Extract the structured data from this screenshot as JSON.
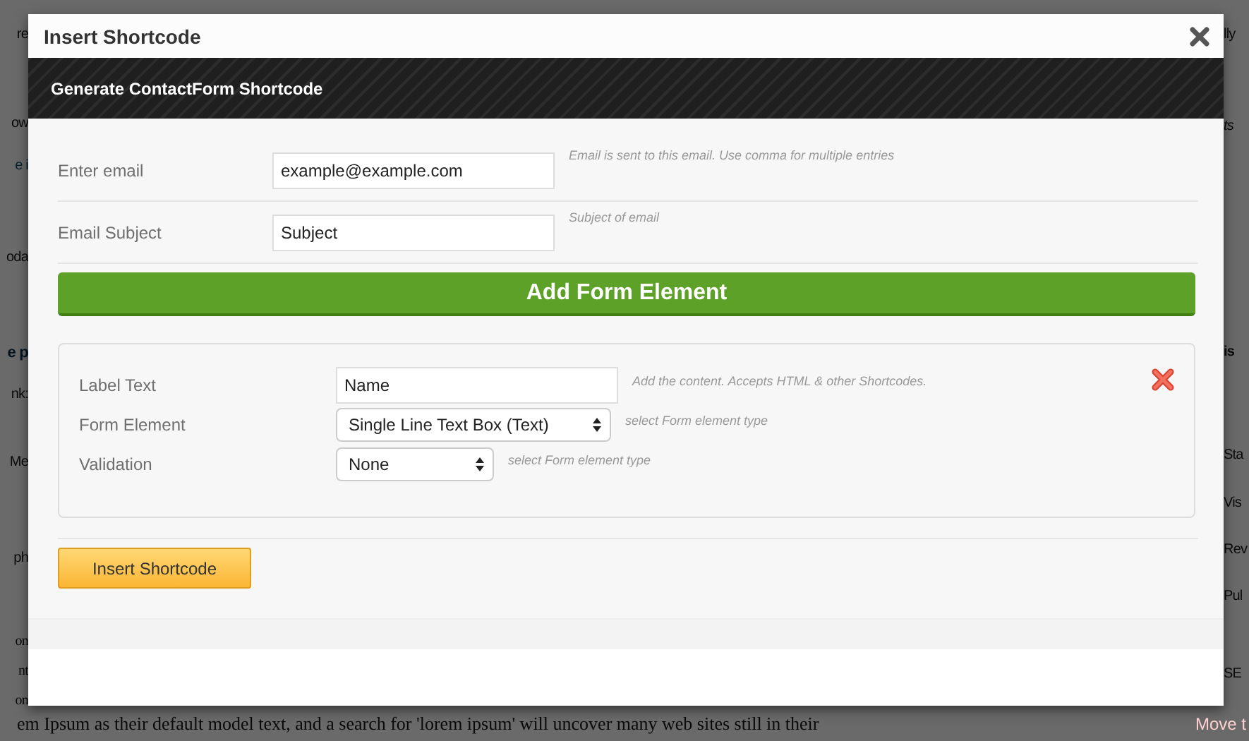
{
  "backdrop": {
    "left_fragments": [
      {
        "text": "re",
        "kind": "plain"
      },
      {
        "text": "ow",
        "kind": "plain"
      },
      {
        "text": "e i",
        "kind": "link"
      },
      {
        "text": "oda",
        "kind": "plain"
      },
      {
        "text": "e p",
        "kind": "heading"
      },
      {
        "text": "nk:",
        "kind": "plain"
      },
      {
        "text": "Me",
        "kind": "plain"
      },
      {
        "text": "ph",
        "kind": "plain"
      },
      {
        "text": "on",
        "kind": "serif"
      },
      {
        "text": "nt",
        "kind": "serif"
      },
      {
        "text": "on",
        "kind": "serif"
      }
    ],
    "right_fragments": [
      {
        "text": "lly",
        "kind": "plain"
      },
      {
        "text": "ts",
        "kind": "italic"
      },
      {
        "text": "is",
        "kind": "bold"
      },
      {
        "text": "Sta",
        "kind": "plain"
      },
      {
        "text": "Vis",
        "kind": "plain"
      },
      {
        "text": "Rev",
        "kind": "plain"
      },
      {
        "text": "Pul",
        "kind": "plain"
      },
      {
        "text": "SE",
        "kind": "plain"
      }
    ],
    "bottom_line": "em Ipsum as their default model text, and a search for 'lorem ipsum' will uncover many web sites still in their",
    "bottom_link": "Move t"
  },
  "dialog": {
    "title": "Insert Shortcode",
    "header": "Generate ContactForm Shortcode",
    "fields": [
      {
        "label": "Enter email",
        "value": "example@example.com",
        "hint": "Email is sent to this email. Use comma for multiple entries"
      },
      {
        "label": "Email Subject",
        "value": "Subject",
        "hint": "Subject of email"
      }
    ],
    "add_button": "Add Form Element",
    "element_rows": [
      {
        "kind": "text",
        "label": "Label Text",
        "value": "Name",
        "hint": "Add the content. Accepts HTML & other Shortcodes."
      },
      {
        "kind": "select",
        "label": "Form Element",
        "value": "Single Line Text Box (Text)",
        "hint": "select Form element type"
      },
      {
        "kind": "select",
        "label": "Validation",
        "value": "None",
        "hint": "select Form element type"
      }
    ],
    "insert_button": "Insert Shortcode"
  }
}
